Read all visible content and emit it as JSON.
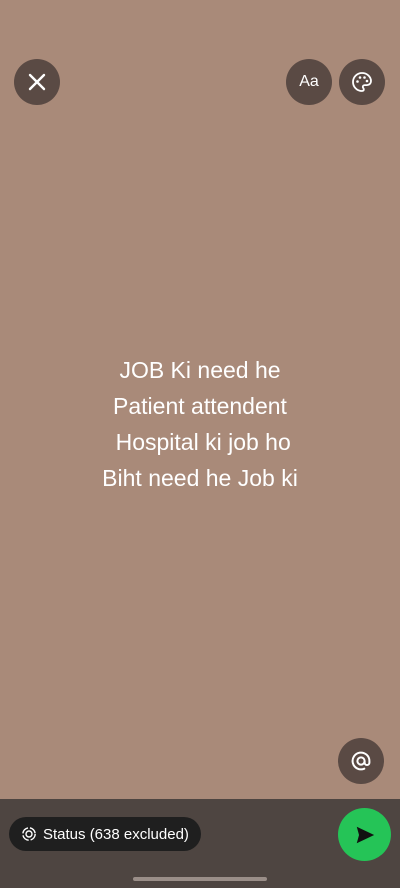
{
  "toolbar": {
    "font_button_label": "Aa",
    "icons": {
      "close": "close-icon",
      "palette": "palette-icon",
      "mention": "mention-icon"
    }
  },
  "status": {
    "lines": [
      "JOB Ki need he",
      "Patient attendent",
      " Hospital ki job ho",
      "Biht need he Job ki"
    ],
    "background_color": "#a98a79"
  },
  "footer": {
    "audience_label": "Status (638 excluded)",
    "send_color": "#25c457"
  }
}
